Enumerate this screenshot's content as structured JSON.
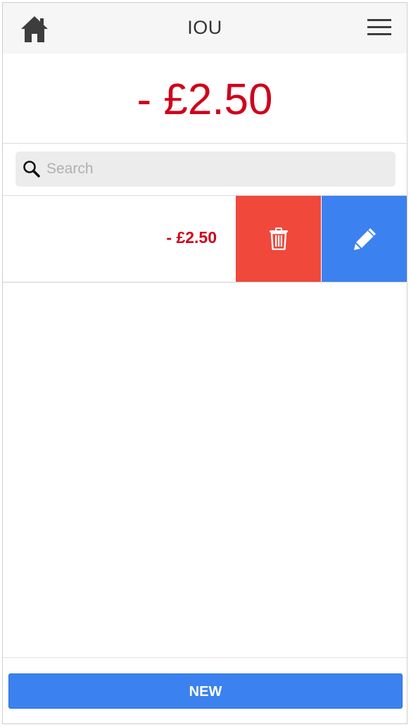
{
  "header": {
    "title": "IOU",
    "home_icon": "home-icon",
    "menu_icon": "hamburger-menu-icon"
  },
  "balance": {
    "text": "- £2.50",
    "color": "#d0021b"
  },
  "search": {
    "placeholder": "Search",
    "value": "",
    "icon": "search-icon"
  },
  "list": {
    "items": [
      {
        "amount": "- £2.50",
        "delete_icon": "trash-icon",
        "edit_icon": "pencil-icon"
      }
    ]
  },
  "footer": {
    "new_label": "NEW"
  },
  "colors": {
    "negative": "#d0021b",
    "delete": "#f0483b",
    "accent": "#3b82f0",
    "header_bg": "#f6f6f6"
  }
}
